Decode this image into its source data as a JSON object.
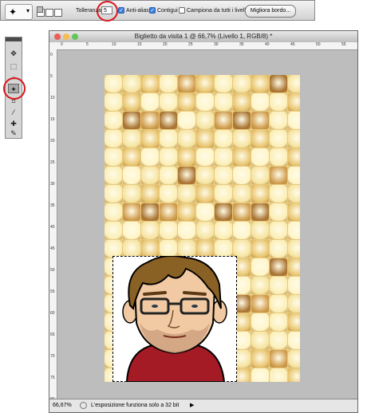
{
  "options_bar": {
    "tool_icon": "magic-wand-icon",
    "tolerance_label": "Tolleranza:",
    "tolerance_value": "5",
    "antialias_label": "Anti-alias",
    "antialias_checked": true,
    "contigui_label": "Contigui",
    "contigui_checked": true,
    "sample_all_label": "Campiona da tutti i livelli",
    "sample_all_checked": false,
    "refine_button": "Migliora bordo..."
  },
  "toolbox": {
    "tools": [
      "move-icon",
      "marquee-icon",
      "lasso-icon",
      "magic-wand-icon",
      "crop-icon",
      "eyedropper-icon",
      "healing-icon",
      "brush-icon"
    ],
    "active_tool": "magic-wand-icon"
  },
  "document": {
    "title": "Biglietto da visita 1 @ 66,7% (Livello 1, RGB/8) *",
    "ruler_h_labels": [
      "0",
      "5",
      "10",
      "15",
      "20",
      "25",
      "30",
      "35",
      "40",
      "45",
      "50",
      "55"
    ],
    "ruler_v_labels": [
      "0",
      "5",
      "10",
      "15",
      "20",
      "25",
      "30",
      "35",
      "40",
      "45",
      "50",
      "55",
      "60",
      "65",
      "70",
      "75",
      "80"
    ]
  },
  "status_bar": {
    "zoom": "66,67%",
    "message": "L'esposizione funziona solo a 32 bit"
  },
  "colors": {
    "highlight_ring": "#d9161c",
    "checkbox_on": "#3a7fe0",
    "close_button": "#ed5e56",
    "minimize_button": "#f5be4f",
    "zoom_button": "#62c655",
    "shirt": "#a51b25",
    "hair": "#8a6125"
  }
}
